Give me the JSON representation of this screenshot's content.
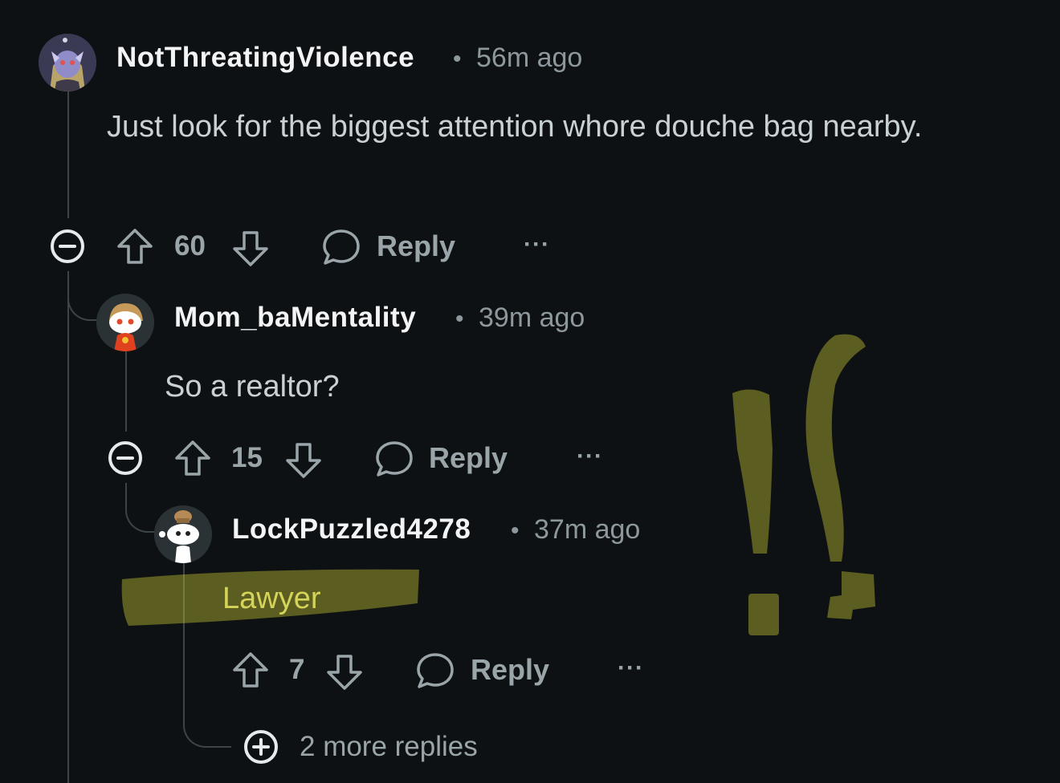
{
  "comments": [
    {
      "username": "NotThreatingViolence",
      "time": "56m ago",
      "body": "Just look for the biggest attention whore douche bag nearby.",
      "score": "60",
      "reply_label": "Reply",
      "more_label": "···"
    },
    {
      "username": "Mom_baMentality",
      "time": "39m ago",
      "body": "So a realtor?",
      "score": "15",
      "reply_label": "Reply",
      "more_label": "···"
    },
    {
      "username": "LockPuzzled4278",
      "time": "37m ago",
      "body": "Lawyer",
      "score": "7",
      "reply_label": "Reply",
      "more_label": "···"
    }
  ],
  "separator": "•",
  "more_replies_label": "2 more replies",
  "colors": {
    "background": "#0e1113",
    "highlight": "#c8c832",
    "highlight_text": "#d4d45a"
  }
}
